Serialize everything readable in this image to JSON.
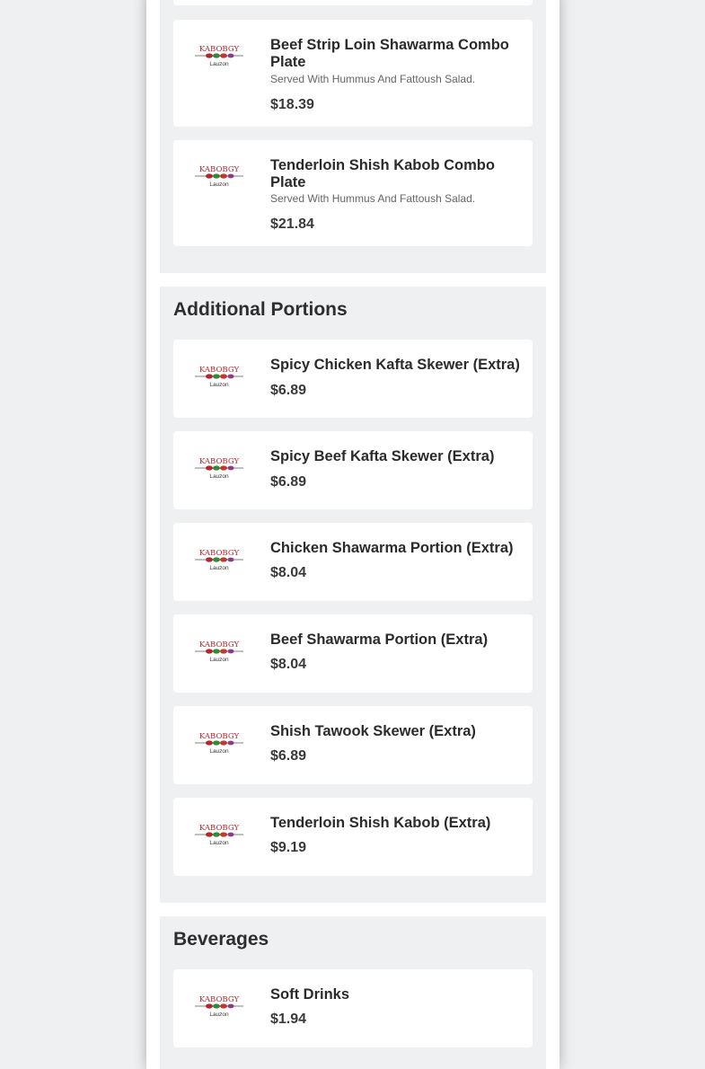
{
  "logo": {
    "word_top": "KABOBGY",
    "word_bottom": "Lauzon"
  },
  "colors": {
    "logo_red": "#b3262e",
    "logo_green": "#2f8a3a",
    "price": "#3a3a3a",
    "section_bg": "#eff0f2"
  },
  "sections": [
    {
      "items": [
        {
          "name": "Beef Strip Loin Shawarma Combo Plate",
          "desc": "Served With Hummus And Fattoush Salad.",
          "price": "$18.39"
        },
        {
          "name": "Tenderloin Shish Kabob Combo Plate",
          "desc": "Served With Hummus And Fattoush Salad.",
          "price": "$21.84"
        }
      ]
    },
    {
      "title": "Additional Portions",
      "items": [
        {
          "name": "Spicy Chicken Kafta Skewer (Extra)",
          "price": "$6.89"
        },
        {
          "name": "Spicy Beef Kafta Skewer (Extra)",
          "price": "$6.89"
        },
        {
          "name": "Chicken Shawarma Portion (Extra)",
          "price": "$8.04"
        },
        {
          "name": "Beef Shawarma Portion (Extra)",
          "price": "$8.04"
        },
        {
          "name": "Shish Tawook Skewer (Extra)",
          "price": "$6.89"
        },
        {
          "name": "Tenderloin Shish Kabob (Extra)",
          "price": "$9.19"
        }
      ]
    },
    {
      "title": "Beverages",
      "items": [
        {
          "name": "Soft Drinks",
          "price": "$1.94"
        }
      ]
    }
  ]
}
